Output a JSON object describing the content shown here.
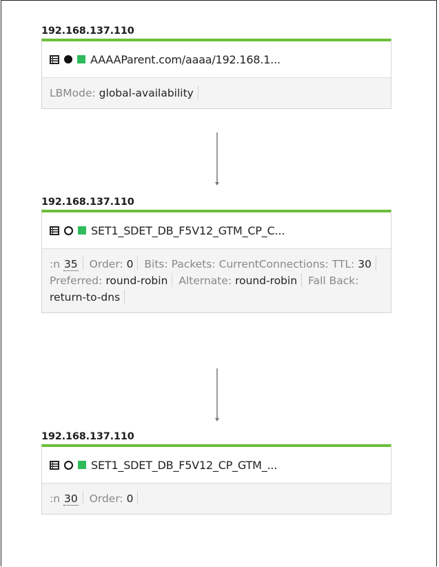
{
  "nodes": [
    {
      "ip": "192.168.137.110",
      "name": "AAAAParent.com/aaaa/192.168.1...",
      "status_dot": "filled",
      "props_line1": [
        {
          "label": "LBMode:",
          "value": "global-availability"
        }
      ]
    },
    {
      "ip": "192.168.137.110",
      "name": "SET1_SDET_DB_F5V12_GTM_CP_C...",
      "status_dot": "empty",
      "n_label": ":n",
      "n_value": "35",
      "order_label": "Order:",
      "order_value": "0",
      "bits_label": "Bits:",
      "packets_label": "Packets:",
      "curconn_label": "CurrentConnections:",
      "ttl_label": "TTL:",
      "ttl_value": "30",
      "preferred_label": "Preferred:",
      "preferred_value": "round-robin",
      "alternate_label": "Alternate:",
      "alternate_value": "round-robin",
      "fallback_label": "Fall Back:",
      "fallback_value": "return-to-dns"
    },
    {
      "ip": "192.168.137.110",
      "name": "SET1_SDET_DB_F5V12_CP_GTM_...",
      "status_dot": "empty",
      "n_label": ":n",
      "n_value": "30",
      "order_label": "Order:",
      "order_value": "0"
    }
  ],
  "colors": {
    "header_bar": "#6cbf3a",
    "status_square": "#2fbb5c"
  },
  "icons": [
    "list-icon",
    "status-dot-icon",
    "status-square-icon"
  ]
}
